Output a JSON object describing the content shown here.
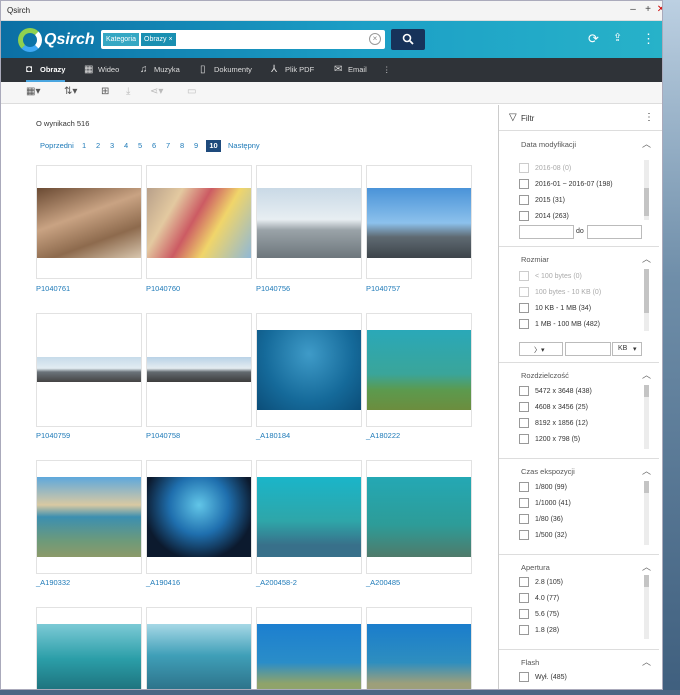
{
  "window": {
    "title": "Qsirch"
  },
  "header": {
    "logo": "Qsirch",
    "search": {
      "chip_category": "Kategoria",
      "chip_value": "Obrazy",
      "chip_remove": "×"
    },
    "icons": [
      "refresh-icon",
      "upload-icon",
      "more-icon"
    ]
  },
  "tabs": [
    {
      "label": "Obrazy",
      "icon": "camera-icon"
    },
    {
      "label": "Wideo",
      "icon": "film-icon"
    },
    {
      "label": "Muzyka",
      "icon": "music-icon"
    },
    {
      "label": "Dokumenty",
      "icon": "document-icon"
    },
    {
      "label": "Plik PDF",
      "icon": "pdf-icon"
    },
    {
      "label": "Email",
      "icon": "mail-icon"
    }
  ],
  "results": {
    "count": "O wynikach 516",
    "pager": {
      "prev": "Poprzedni",
      "pages": [
        "1",
        "2",
        "3",
        "4",
        "5",
        "6",
        "7",
        "8",
        "9",
        "10"
      ],
      "current": "10",
      "next": "Następny"
    },
    "items": [
      {
        "name": "P1040761"
      },
      {
        "name": "P1040760"
      },
      {
        "name": "P1040756"
      },
      {
        "name": "P1040757"
      },
      {
        "name": "P1040759"
      },
      {
        "name": "P1040758"
      },
      {
        "name": "_A180184"
      },
      {
        "name": "_A180222"
      },
      {
        "name": "_A190332"
      },
      {
        "name": "_A190416"
      },
      {
        "name": "_A200458-2"
      },
      {
        "name": "_A200485"
      },
      {
        "name": ""
      },
      {
        "name": ""
      },
      {
        "name": ""
      },
      {
        "name": ""
      }
    ]
  },
  "filter": {
    "title": "Filtr",
    "date": {
      "title": "Data modyfikacji",
      "options": [
        "2016-08 (0)",
        "2016-01 ~ 2016-07 (198)",
        "2015 (31)",
        "2014 (263)"
      ],
      "to": "do"
    },
    "size": {
      "title": "Rozmiar",
      "options": [
        "< 100 bytes (0)",
        "100 bytes - 10 KB (0)",
        "10 KB - 1 MB (34)",
        "1 MB - 100 MB (482)"
      ],
      "unit": "KB"
    },
    "resolution": {
      "title": "Rozdzielczość",
      "options": [
        "5472 x 3648 (438)",
        "4608 x 3456 (25)",
        "8192 x 1856 (12)",
        "1200 x 798 (5)"
      ]
    },
    "exposure": {
      "title": "Czas ekspozycji",
      "options": [
        "1/800 (99)",
        "1/1000 (41)",
        "1/80 (36)",
        "1/500 (32)"
      ]
    },
    "aperture": {
      "title": "Apertura",
      "options": [
        "2.8 (105)",
        "4.0 (77)",
        "5.6 (75)",
        "1.8 (28)"
      ]
    },
    "flash": {
      "title": "Flash",
      "options": [
        "Wył. (485)"
      ]
    }
  }
}
